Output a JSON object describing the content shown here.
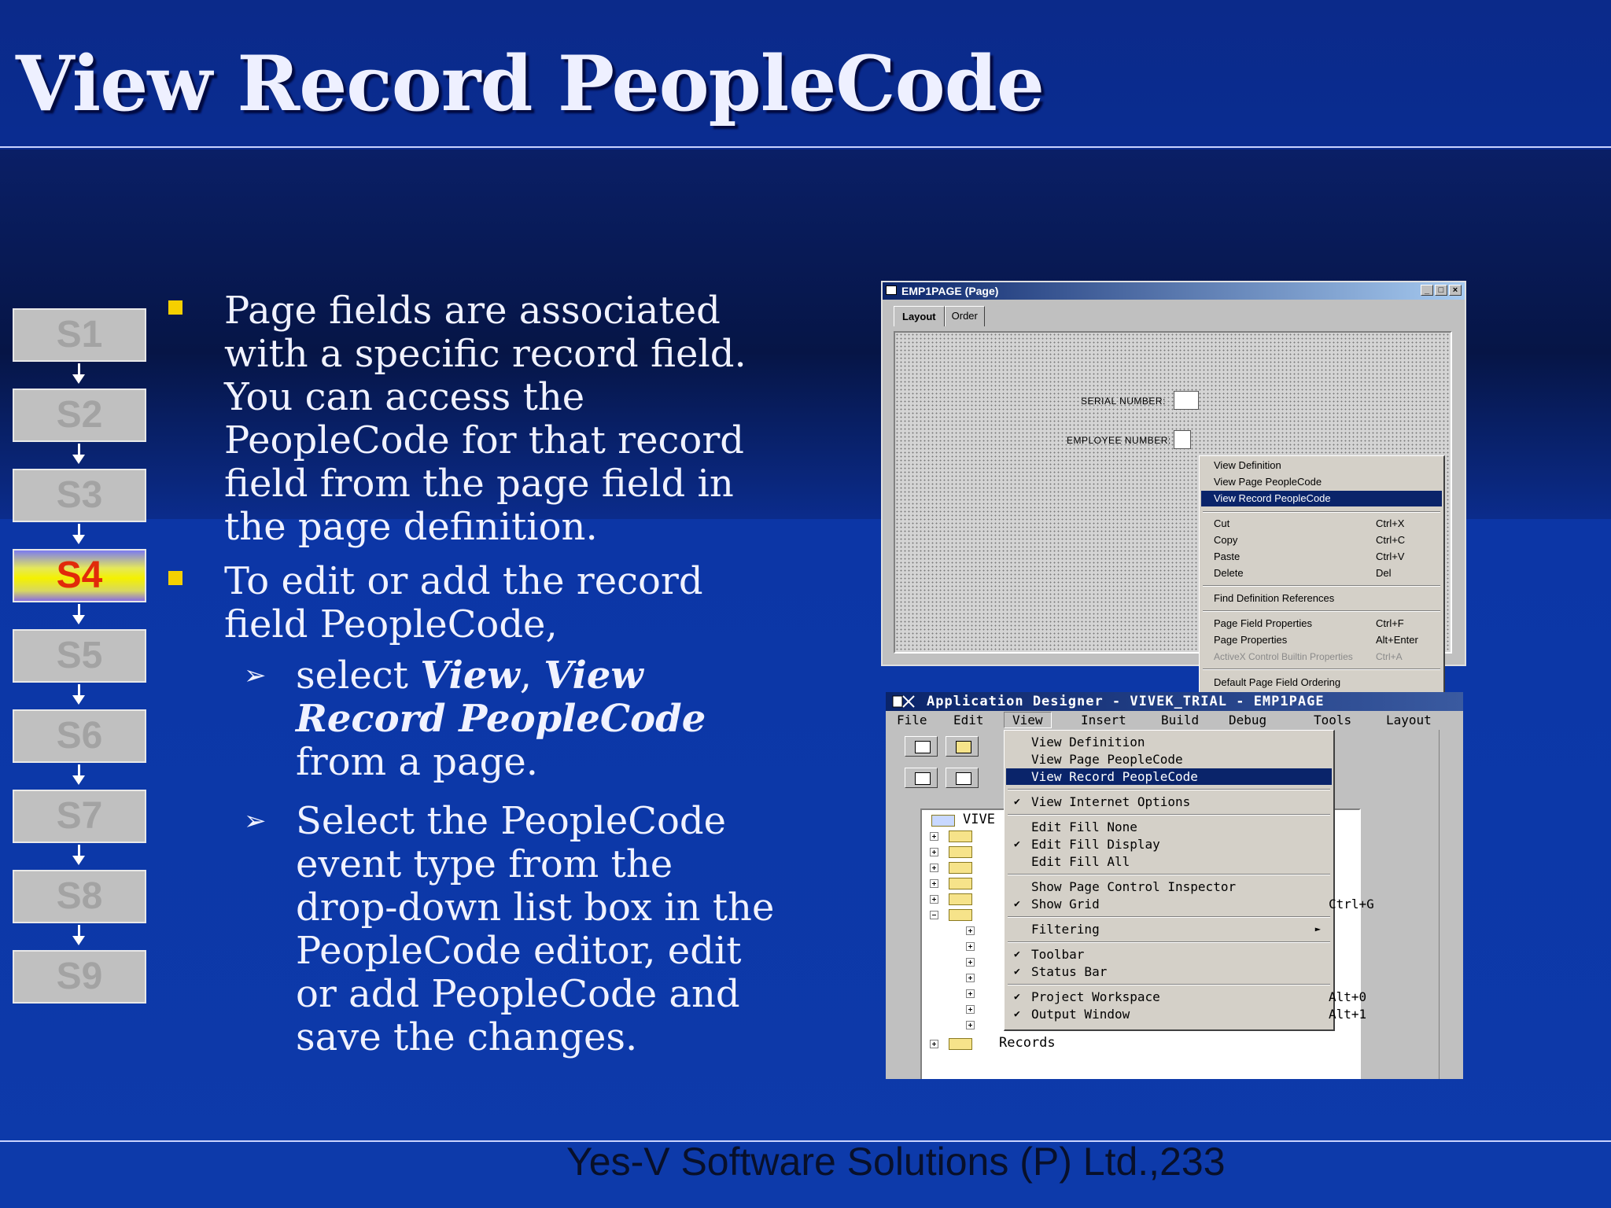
{
  "slide": {
    "title": "View Record PeopleCode",
    "footer": "Yes-V Software Solutions (P) Ltd.,233"
  },
  "nav": {
    "steps": [
      "S1",
      "S2",
      "S3",
      "S4",
      "S5",
      "S6",
      "S7",
      "S8",
      "S9"
    ],
    "active": "S4"
  },
  "bullets": {
    "b1": "Page fields are associated with a specific record field. You can access the PeopleCode for that record field from the page field in the page definition.",
    "b2": "To edit or add the record field PeopleCode,",
    "sub1_pre": " select ",
    "sub1_view": "View",
    "sub1_comma": ", ",
    "sub1_vrpc": "View Record PeopleCode",
    "sub1_post": " from a page.",
    "sub2": "Select the PeopleCode event type from the drop-down list box in the PeopleCode editor, edit or add PeopleCode and save the changes."
  },
  "shot1": {
    "title": "EMP1PAGE (Page)",
    "tabs": [
      "Layout",
      "Order"
    ],
    "fields": [
      "SERIAL NUMBER:",
      "EMPLOYEE NUMBER:"
    ],
    "menu": [
      {
        "label": "View Definition",
        "shortcut": ""
      },
      {
        "label": "View Page PeopleCode",
        "shortcut": ""
      },
      {
        "label": "View Record PeopleCode",
        "shortcut": ""
      },
      {
        "label": "Cut",
        "shortcut": "Ctrl+X"
      },
      {
        "label": "Copy",
        "shortcut": "Ctrl+C"
      },
      {
        "label": "Paste",
        "shortcut": "Ctrl+V"
      },
      {
        "label": "Delete",
        "shortcut": "Del"
      },
      {
        "label": "Find Definition References",
        "shortcut": ""
      },
      {
        "label": "Page Field Properties",
        "shortcut": "Ctrl+F"
      },
      {
        "label": "Page Properties",
        "shortcut": "Alt+Enter"
      },
      {
        "label": "ActiveX Control Builtin Properties",
        "shortcut": "Ctrl+A"
      },
      {
        "label": "Default Page Field Ordering",
        "shortcut": ""
      }
    ]
  },
  "shot2": {
    "title": "Application Designer - VIVEK_TRIAL - EMP1PAGE",
    "menubar": [
      "File",
      "Edit",
      "View",
      "Insert",
      "Build",
      "Debug",
      "Tools",
      "Layout"
    ],
    "tree_root": "VIVE",
    "tree_last": "Records",
    "menu": [
      {
        "label": "View Definition",
        "check": "",
        "shortcut": ""
      },
      {
        "label": "View Page PeopleCode",
        "check": "",
        "shortcut": ""
      },
      {
        "label": "View Record PeopleCode",
        "check": "",
        "shortcut": ""
      },
      {
        "label": "View Internet Options",
        "check": "✔",
        "shortcut": ""
      },
      {
        "label": "Edit Fill None",
        "check": "",
        "shortcut": ""
      },
      {
        "label": "Edit Fill Display",
        "check": "✔",
        "shortcut": ""
      },
      {
        "label": "Edit Fill All",
        "check": "",
        "shortcut": ""
      },
      {
        "label": "Show Page Control Inspector",
        "check": "",
        "shortcut": ""
      },
      {
        "label": "Show Grid",
        "check": "✔",
        "shortcut": "Ctrl+G"
      },
      {
        "label": "Filtering",
        "check": "",
        "shortcut": "►"
      },
      {
        "label": "Toolbar",
        "check": "✔",
        "shortcut": ""
      },
      {
        "label": "Status Bar",
        "check": "✔",
        "shortcut": ""
      },
      {
        "label": "Project Workspace",
        "check": "✔",
        "shortcut": "Alt+0"
      },
      {
        "label": "Output Window",
        "check": "✔",
        "shortcut": "Alt+1"
      }
    ]
  },
  "colors": {
    "bullet": "#f5d000",
    "highlight": "#0a246a",
    "active_step_text": "#e12a0a"
  }
}
